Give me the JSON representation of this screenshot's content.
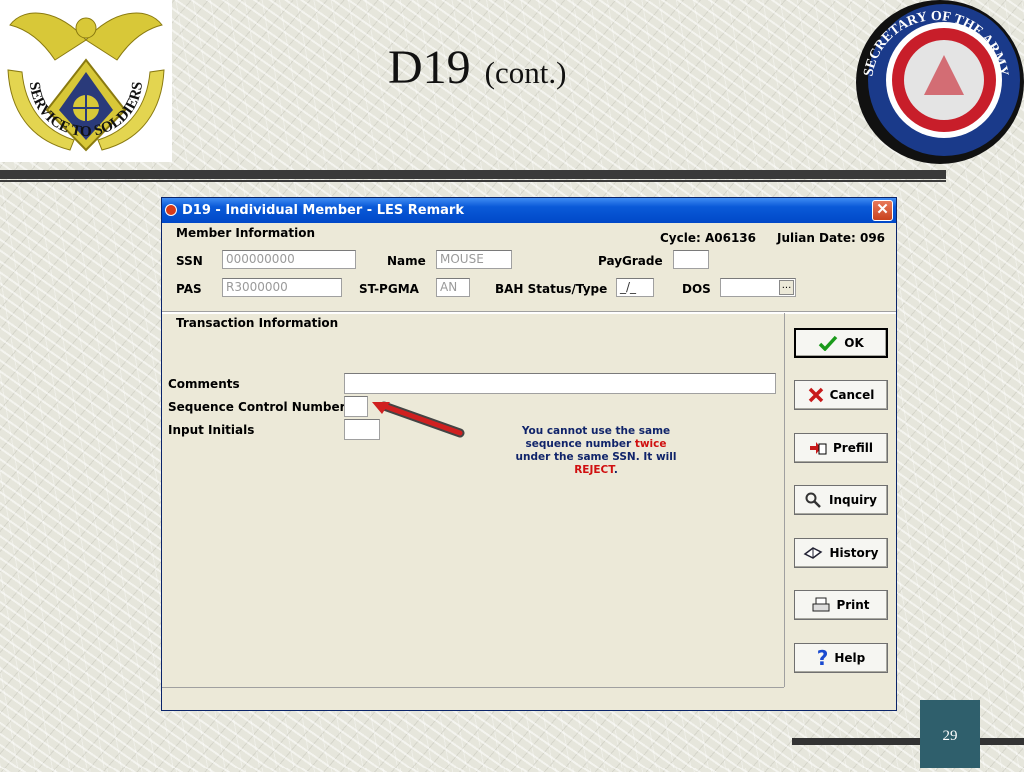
{
  "slide": {
    "title": "D19",
    "subtitle": "(cont.)",
    "page_number": "29",
    "left_logo_text": "SERVICE TO SOLDIERS",
    "right_logo_text": "SECRETARY OF THE ARMY"
  },
  "window": {
    "title": "D19 - Individual Member - LES Remark",
    "close_label": "✕"
  },
  "member": {
    "section_label": "Member Information",
    "cycle": "Cycle: A06136",
    "julian_date": "Julian Date: 096",
    "ssn_label": "SSN",
    "ssn_value": "000000000",
    "name_label": "Name",
    "name_value": "MOUSE",
    "paygrade_label": "PayGrade",
    "paygrade_value": "",
    "pas_label": "PAS",
    "pas_value": "R3000000",
    "stpgma_label": "ST-PGMA",
    "stpgma_value": "AN",
    "bah_label": "BAH Status/Type",
    "bah_value": "_/_",
    "dos_label": "DOS",
    "dos_value": "",
    "dos_button": "..."
  },
  "transaction": {
    "section_label": "Transaction Information",
    "comments_label": "Comments",
    "comments_value": "",
    "sequence_label": "Sequence Control Number",
    "sequence_value": "",
    "initials_label": "Input Initials",
    "initials_value": ""
  },
  "note": {
    "part1": "You cannot use the same sequence number",
    "part2": "twice",
    "part3": "under the same SSN. It will",
    "part4": "REJECT",
    "part5": "."
  },
  "buttons": {
    "ok": "OK",
    "cancel": "Cancel",
    "prefill": "Prefill",
    "inquiry": "Inquiry",
    "history": "History",
    "print": "Print",
    "help": "Help"
  },
  "colors": {
    "titlebar": "#0a5ad8",
    "window_bg": "#ece9d8",
    "note_text": "#10246a",
    "note_highlight": "#d01010",
    "arrow": "#d02020"
  }
}
